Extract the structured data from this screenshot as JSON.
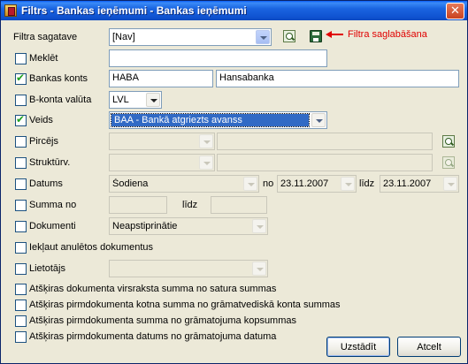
{
  "window": {
    "title": "Filtrs - Bankas ieņēmumi - Bankas ieņēmumi",
    "close": "✕"
  },
  "template": {
    "label": "Filtra sagatave",
    "value": "[Nav]",
    "save_annotation": "Filtra saglabāšana"
  },
  "search": {
    "label": "Meklēt",
    "checked": false,
    "value": ""
  },
  "bank_account": {
    "label": "Bankas konts",
    "checked": true,
    "code": "HABA",
    "name": "Hansabanka"
  },
  "currency": {
    "label": "B-konta valūta",
    "checked": false,
    "value": "LVL"
  },
  "type": {
    "label": "Veids",
    "checked": true,
    "value": "BAA - Bankā atgriezts avanss"
  },
  "payer": {
    "label": "Pircējs",
    "checked": false,
    "code": "",
    "name": ""
  },
  "structure": {
    "label": "Struktūrv.",
    "checked": false,
    "code": "",
    "name": ""
  },
  "date": {
    "label": "Datums",
    "checked": false,
    "period": "Šodiena",
    "from_label": "no",
    "from": "23.11.2007",
    "to_label": "līdz",
    "to": "23.11.2007"
  },
  "amount": {
    "label": "Summa no",
    "checked": false,
    "from": "",
    "to_label": "līdz",
    "to": ""
  },
  "documents": {
    "label": "Dokumenti",
    "checked": false,
    "value": "Neapstiprinātie"
  },
  "include_cancelled": {
    "label": "Iekļaut anulētos dokumentus",
    "checked": false
  },
  "user": {
    "label": "Lietotājs",
    "checked": false,
    "value": ""
  },
  "extra_checks": [
    {
      "label": "Atšķiras dokumenta virsraksta summa no satura summas",
      "checked": false
    },
    {
      "label": "Atšķiras pirmdokumenta kotna summa no grāmatvediskā konta summas",
      "checked": false
    },
    {
      "label": "Atšķiras pirmdokumenta summa no grāmatojuma kopsummas",
      "checked": false
    },
    {
      "label": "Atšķiras pirmdokumenta datums no grāmatojuma datuma",
      "checked": false
    }
  ],
  "buttons": {
    "ok": "Uzstādīt",
    "cancel": "Atcelt"
  },
  "colors": {
    "titlebar": "#0a5ef7",
    "face": "#ece9d8",
    "annotation": "#e00000",
    "selection": "#316ac5"
  }
}
